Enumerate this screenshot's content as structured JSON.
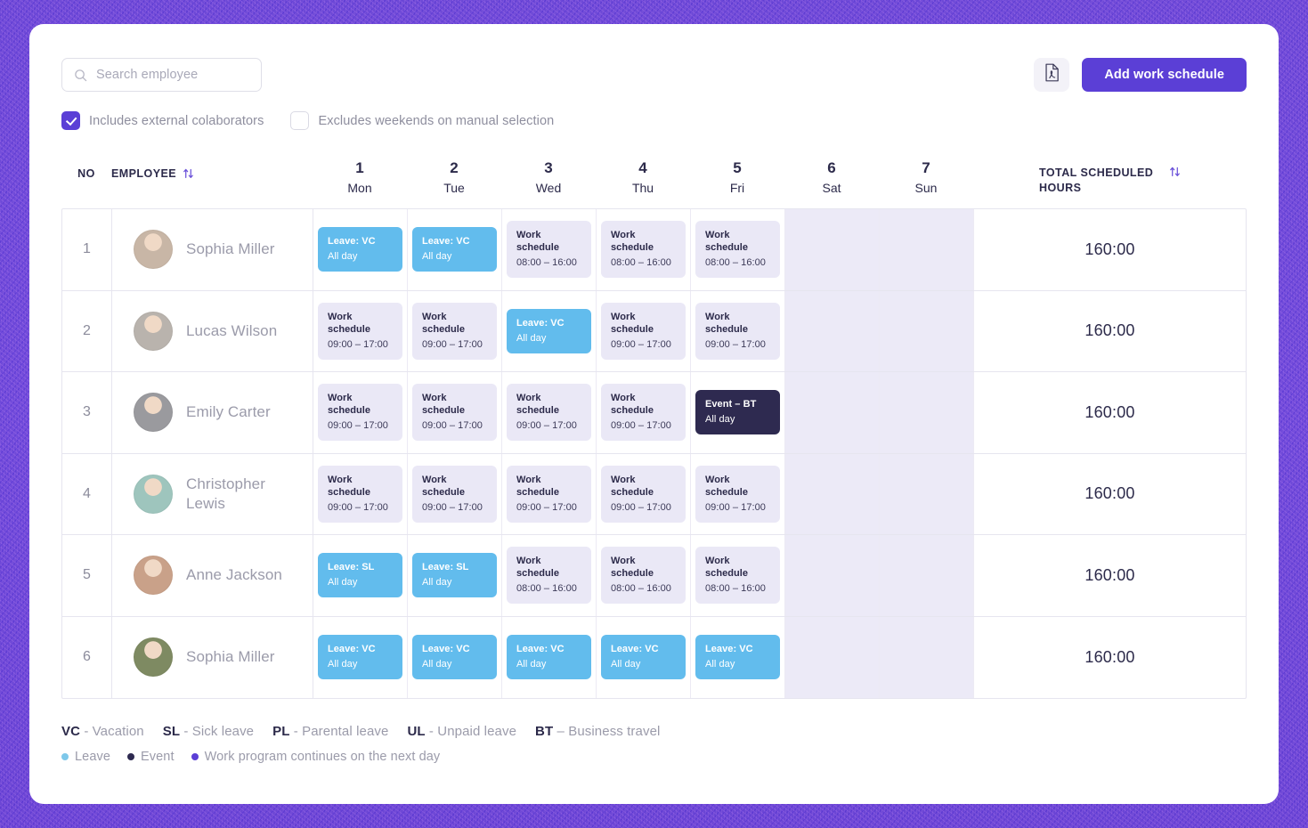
{
  "search": {
    "placeholder": "Search employee",
    "icon": "search-icon"
  },
  "toolbar": {
    "export_icon": "pdf-file-icon",
    "add_label": "Add work schedule"
  },
  "options": {
    "include_external": {
      "label": "Includes external colaborators",
      "checked": true
    },
    "exclude_weekends": {
      "label": "Excludes weekends on manual selection",
      "checked": false
    }
  },
  "table": {
    "col_no": "NO",
    "col_employee": "EMPLOYEE",
    "col_total": "TOTAL SCHEDULED HOURS",
    "sort_icon": "sort-updown-icon",
    "days": [
      {
        "num": "1",
        "name": "Mon",
        "weekend": false
      },
      {
        "num": "2",
        "name": "Tue",
        "weekend": false
      },
      {
        "num": "3",
        "name": "Wed",
        "weekend": false
      },
      {
        "num": "4",
        "name": "Thu",
        "weekend": false
      },
      {
        "num": "5",
        "name": "Fri",
        "weekend": false
      },
      {
        "num": "6",
        "name": "Sat",
        "weekend": true
      },
      {
        "num": "7",
        "name": "Sun",
        "weekend": true
      }
    ],
    "rows": [
      {
        "no": "1",
        "name": "Sophia Miller",
        "total": "160:00",
        "avatar": "#c8b6a6",
        "cells": [
          {
            "type": "leave",
            "l1": "Leave: VC",
            "l2": "All day"
          },
          {
            "type": "leave",
            "l1": "Leave: VC",
            "l2": "All day"
          },
          {
            "type": "work",
            "l1": "Work schedule",
            "l2": "08:00 – 16:00"
          },
          {
            "type": "work",
            "l1": "Work schedule",
            "l2": "08:00 – 16:00"
          },
          {
            "type": "work",
            "l1": "Work schedule",
            "l2": "08:00 – 16:00"
          },
          {
            "type": "empty"
          },
          {
            "type": "empty"
          }
        ]
      },
      {
        "no": "2",
        "name": "Lucas Wilson",
        "total": "160:00",
        "avatar": "#b9b3ad",
        "cells": [
          {
            "type": "work",
            "l1": "Work schedule",
            "l2": "09:00 – 17:00"
          },
          {
            "type": "work",
            "l1": "Work schedule",
            "l2": "09:00 – 17:00"
          },
          {
            "type": "leave",
            "l1": "Leave: VC",
            "l2": "All day"
          },
          {
            "type": "work",
            "l1": "Work schedule",
            "l2": "09:00 – 17:00"
          },
          {
            "type": "work",
            "l1": "Work schedule",
            "l2": "09:00 – 17:00"
          },
          {
            "type": "empty"
          },
          {
            "type": "empty"
          }
        ]
      },
      {
        "no": "3",
        "name": "Emily Carter",
        "total": "160:00",
        "avatar": "#9a9a9e",
        "cells": [
          {
            "type": "work",
            "l1": "Work schedule",
            "l2": "09:00 – 17:00"
          },
          {
            "type": "work",
            "l1": "Work schedule",
            "l2": "09:00 – 17:00"
          },
          {
            "type": "work",
            "l1": "Work schedule",
            "l2": "09:00 – 17:00"
          },
          {
            "type": "work",
            "l1": "Work schedule",
            "l2": "09:00 – 17:00"
          },
          {
            "type": "event",
            "l1": "Event – BT",
            "l2": "All day"
          },
          {
            "type": "empty"
          },
          {
            "type": "empty"
          }
        ]
      },
      {
        "no": "4",
        "name": "Christopher Lewis",
        "total": "160:00",
        "avatar": "#9ec5bd",
        "cells": [
          {
            "type": "work",
            "l1": "Work schedule",
            "l2": "09:00 – 17:00"
          },
          {
            "type": "work",
            "l1": "Work schedule",
            "l2": "09:00 – 17:00"
          },
          {
            "type": "work",
            "l1": "Work schedule",
            "l2": "09:00 – 17:00"
          },
          {
            "type": "work",
            "l1": "Work schedule",
            "l2": "09:00 – 17:00"
          },
          {
            "type": "work",
            "l1": "Work schedule",
            "l2": "09:00 – 17:00"
          },
          {
            "type": "empty"
          },
          {
            "type": "empty"
          }
        ]
      },
      {
        "no": "5",
        "name": "Anne Jackson",
        "total": "160:00",
        "avatar": "#c9a189",
        "cells": [
          {
            "type": "leave",
            "l1": "Leave: SL",
            "l2": "All day"
          },
          {
            "type": "leave",
            "l1": "Leave: SL",
            "l2": "All day"
          },
          {
            "type": "work",
            "l1": "Work schedule",
            "l2": "08:00 – 16:00"
          },
          {
            "type": "work",
            "l1": "Work schedule",
            "l2": "08:00 – 16:00"
          },
          {
            "type": "work",
            "l1": "Work schedule",
            "l2": "08:00 – 16:00"
          },
          {
            "type": "empty"
          },
          {
            "type": "empty"
          }
        ]
      },
      {
        "no": "6",
        "name": "Sophia Miller",
        "total": "160:00",
        "avatar": "#7e8a62",
        "cells": [
          {
            "type": "leave",
            "l1": "Leave: VC",
            "l2": "All day"
          },
          {
            "type": "leave",
            "l1": "Leave: VC",
            "l2": "All day"
          },
          {
            "type": "leave",
            "l1": "Leave: VC",
            "l2": "All day"
          },
          {
            "type": "leave",
            "l1": "Leave: VC",
            "l2": "All day"
          },
          {
            "type": "leave",
            "l1": "Leave: VC",
            "l2": "All day"
          },
          {
            "type": "empty"
          },
          {
            "type": "empty"
          }
        ]
      }
    ]
  },
  "legend": {
    "abbreviations": [
      {
        "code": "VC",
        "text": " - Vacation"
      },
      {
        "code": "SL",
        "text": " - Sick leave"
      },
      {
        "code": "PL",
        "text": " - Parental leave"
      },
      {
        "code": "UL",
        "text": " - Unpaid leave"
      },
      {
        "code": "BT",
        "text": " – Business travel"
      }
    ],
    "markers": [
      {
        "label": "Leave",
        "color": "#7ec8ea"
      },
      {
        "label": "Event",
        "color": "#2e2a50"
      },
      {
        "label": "Work program continues on the next day",
        "color": "#5b3fd6"
      }
    ]
  },
  "colors": {
    "accent": "#5b3fd6",
    "leave": "#62bced",
    "event": "#2e2a50",
    "work": "#eae8f6",
    "weekend": "#eceaf7"
  }
}
